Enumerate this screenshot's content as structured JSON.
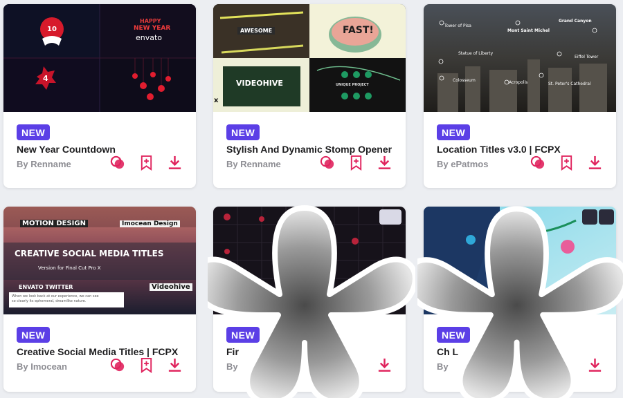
{
  "cards": [
    {
      "badge": "NEW",
      "title": "New Year Countdown",
      "author": "By Renname",
      "thumb": {
        "number_top": "10",
        "number_bottom": "4",
        "greeting_line1": "HAPPY",
        "greeting_line2": "NEW YEAR",
        "brand": "envato"
      }
    },
    {
      "badge": "NEW",
      "title": "Stylish And Dynamic Stomp Opener",
      "author": "By Renname",
      "thumb": {
        "label_awesome": "AWESOME",
        "label_fast": "FAST!",
        "label_videohive": "VIDEOHIVE",
        "label_unique": "UNIQUE PROJECT",
        "label_x": "x"
      }
    },
    {
      "badge": "NEW",
      "title": "Location Titles v3.0 | FCPX",
      "author": "By ePatmos",
      "thumb": {
        "locations": [
          "Tower of Pisa",
          "Mont Saint Michel",
          "Grand Canyon",
          "Statue of Liberty",
          "Eiffel Tower",
          "Colosseum",
          "Acropolis",
          "St. Peter's Cathedral"
        ]
      }
    },
    {
      "badge": "NEW",
      "title": "Creative Social Media Titles | FCPX",
      "author": "By Imocean",
      "thumb": {
        "motion_design": "MOTION DESIGN",
        "imocean_design": "Imocean Design",
        "headline": "CREATIVE SOCIAL MEDIA TITLES",
        "version": "Version for Final Cut Pro X",
        "envato_twitter": "ENVATO TWITTER",
        "videohive": "Videohive",
        "tweet_line1": "When we look back at our experience, we can see",
        "tweet_line2": "so clearly its ephemeral, dreamlike nature."
      }
    },
    {
      "badge": "NEW",
      "title": "Fir",
      "author": "By",
      "thumb": {}
    },
    {
      "badge": "NEW",
      "title": "Ch                    L",
      "author": "By",
      "thumb": {}
    }
  ],
  "colors": {
    "badge": "#5b3fe6",
    "action_accent": "#e0245e",
    "title": "#1d1d1f",
    "author": "#8d8d93"
  },
  "icons": {
    "preview": "overlap-circles-icon",
    "bookmark": "bookmark-plus-icon",
    "download": "download-icon"
  }
}
